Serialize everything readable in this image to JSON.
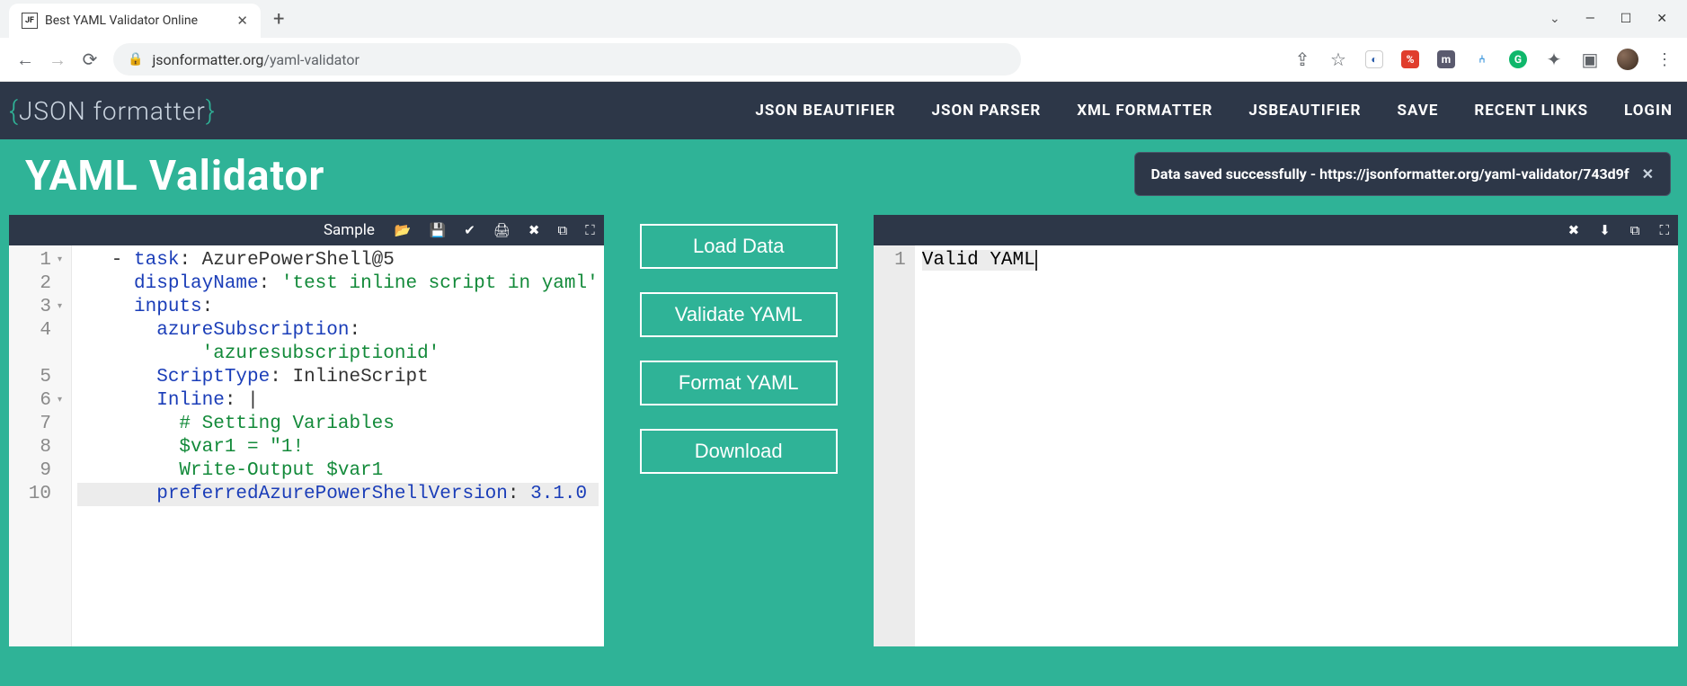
{
  "browser": {
    "tab_favicon": "JF",
    "tab_title": "Best YAML Validator Online",
    "url_host": "jsonformatter.org",
    "url_path": "/yaml-validator",
    "window_labels": {
      "minimize": "Minimize",
      "maximize": "Maximize",
      "close": "Close"
    }
  },
  "site": {
    "logo_text": "JSON formatter",
    "nav": [
      "JSON BEAUTIFIER",
      "JSON PARSER",
      "XML FORMATTER",
      "JSBEAUTIFIER",
      "SAVE",
      "RECENT LINKS",
      "LOGIN"
    ]
  },
  "page": {
    "title": "YAML Validator",
    "toast": "Data saved successfully - https://jsonformatter.org/yaml-validator/743d9f"
  },
  "editor": {
    "sample_label": "Sample",
    "gutter": [
      {
        "n": "1",
        "fold": true
      },
      {
        "n": "2",
        "fold": false
      },
      {
        "n": "3",
        "fold": true
      },
      {
        "n": "4",
        "fold": false
      },
      {
        "n": "5",
        "fold": false
      },
      {
        "n": "6",
        "fold": true
      },
      {
        "n": "7",
        "fold": false
      },
      {
        "n": "8",
        "fold": false
      },
      {
        "n": "9",
        "fold": false
      },
      {
        "n": "10",
        "fold": false
      }
    ],
    "lines": [
      [
        {
          "t": "punc",
          "v": "   - "
        },
        {
          "t": "key",
          "v": "task"
        },
        {
          "t": "punc",
          "v": ": "
        },
        {
          "t": "plain",
          "v": "AzurePowerShell@5"
        }
      ],
      [
        {
          "t": "plain",
          "v": "     "
        },
        {
          "t": "key",
          "v": "displayName"
        },
        {
          "t": "punc",
          "v": ": "
        },
        {
          "t": "str",
          "v": "'test inline script in yaml'"
        }
      ],
      [
        {
          "t": "plain",
          "v": "     "
        },
        {
          "t": "key",
          "v": "inputs"
        },
        {
          "t": "punc",
          "v": ":"
        }
      ],
      [
        {
          "t": "plain",
          "v": "       "
        },
        {
          "t": "key",
          "v": "azureSubscription"
        },
        {
          "t": "punc",
          "v": ":"
        }
      ],
      [
        {
          "t": "plain",
          "v": "           "
        },
        {
          "t": "str",
          "v": "'azuresubscriptionid'"
        }
      ],
      [
        {
          "t": "plain",
          "v": "       "
        },
        {
          "t": "key",
          "v": "ScriptType"
        },
        {
          "t": "punc",
          "v": ": "
        },
        {
          "t": "plain",
          "v": "InlineScript"
        }
      ],
      [
        {
          "t": "plain",
          "v": "       "
        },
        {
          "t": "key",
          "v": "Inline"
        },
        {
          "t": "punc",
          "v": ": "
        },
        {
          "t": "plain",
          "v": "|"
        }
      ],
      [
        {
          "t": "plain",
          "v": "         "
        },
        {
          "t": "str",
          "v": "# Setting Variables"
        }
      ],
      [
        {
          "t": "plain",
          "v": "         "
        },
        {
          "t": "str",
          "v": "$var1 = \"1!"
        }
      ],
      [
        {
          "t": "plain",
          "v": "         "
        },
        {
          "t": "str",
          "v": "Write-Output $var1"
        }
      ],
      [
        {
          "t": "plain",
          "v": "       "
        },
        {
          "t": "key",
          "v": "preferredAzurePowerShellVersion"
        },
        {
          "t": "punc",
          "v": ": "
        },
        {
          "t": "num",
          "v": "3.1.0"
        }
      ]
    ]
  },
  "buttons": {
    "load": "Load Data",
    "validate": "Validate YAML",
    "format": "Format YAML",
    "download": "Download"
  },
  "output": {
    "line_no": "1",
    "text": "Valid YAML"
  }
}
